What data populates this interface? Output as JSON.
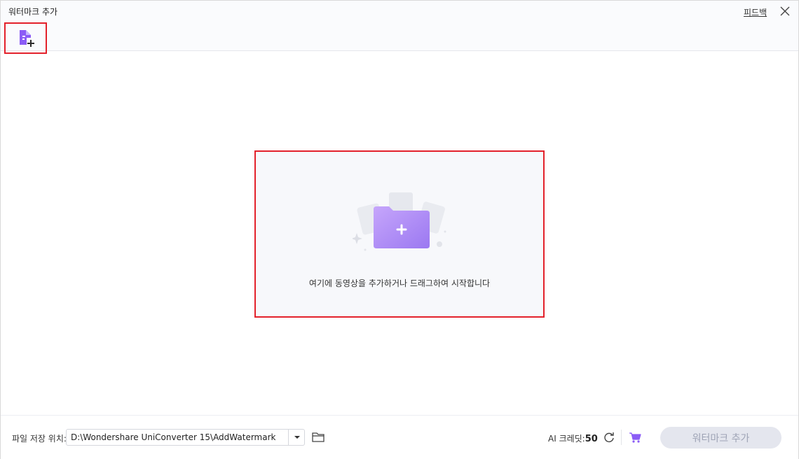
{
  "window": {
    "title": "워터마크 추가",
    "feedback_label": "피드백",
    "close_icon": "close-icon"
  },
  "toolbar": {
    "add_file_icon": "add-file-icon"
  },
  "dropzone": {
    "icon": "folder-add-icon",
    "hint": "여기에 동영상을 추가하거나 드래그하여 시작합니다"
  },
  "footer": {
    "save_location_label": "파일 저장 위치:",
    "save_path": "D:\\Wondershare UniConverter 15\\AddWatermark",
    "credits_label": "AI 크레딧:",
    "credits_value": "50",
    "primary_button_label": "워터마크 추가"
  },
  "colors": {
    "accent": "#8b5cf6",
    "highlight_border": "#e3212b",
    "disabled_button_bg": "#e4e6ee",
    "disabled_button_text": "#9ea3b5"
  }
}
